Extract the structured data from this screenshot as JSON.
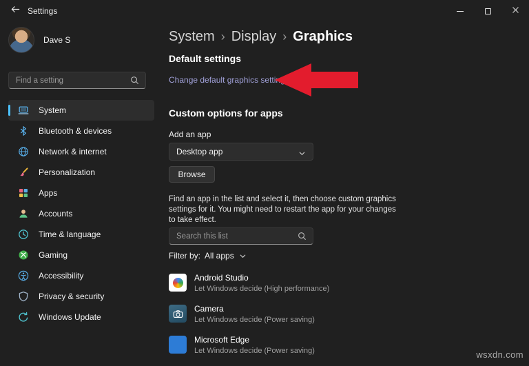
{
  "titlebar": {
    "title": "Settings"
  },
  "sidebar": {
    "user_name": "Dave S",
    "search_placeholder": "Find a setting",
    "items": [
      {
        "label": "System",
        "selected": true
      },
      {
        "label": "Bluetooth & devices"
      },
      {
        "label": "Network & internet"
      },
      {
        "label": "Personalization"
      },
      {
        "label": "Apps"
      },
      {
        "label": "Accounts"
      },
      {
        "label": "Time & language"
      },
      {
        "label": "Gaming"
      },
      {
        "label": "Accessibility"
      },
      {
        "label": "Privacy & security"
      },
      {
        "label": "Windows Update"
      }
    ]
  },
  "main": {
    "breadcrumb": {
      "items": [
        "System",
        "Display",
        "Graphics"
      ],
      "separator": "›"
    },
    "default_settings": {
      "heading": "Default settings",
      "link_label": "Change default graphics settings"
    },
    "custom_options": {
      "heading": "Custom options for apps",
      "add_app_label": "Add an app",
      "app_type_value": "Desktop app",
      "browse_label": "Browse",
      "description": "Find an app in the list and select it, then choose custom graphics settings for it. You might need to restart the app for your changes to take effect.",
      "search_placeholder": "Search this list",
      "filter_label": "Filter by:",
      "filter_value": "All apps",
      "apps": [
        {
          "name": "Android Studio",
          "status": "Let Windows decide (High performance)"
        },
        {
          "name": "Camera",
          "status": "Let Windows decide (Power saving)"
        },
        {
          "name": "Microsoft Edge",
          "status": "Let Windows decide (Power saving)"
        }
      ]
    }
  },
  "annotation": {
    "arrow_color": "#e31c2d"
  },
  "watermark": "wsxdn.com",
  "colors": {
    "accent": "#4cc2ff",
    "link": "#a0a0d8",
    "window_bg": "#202020"
  }
}
